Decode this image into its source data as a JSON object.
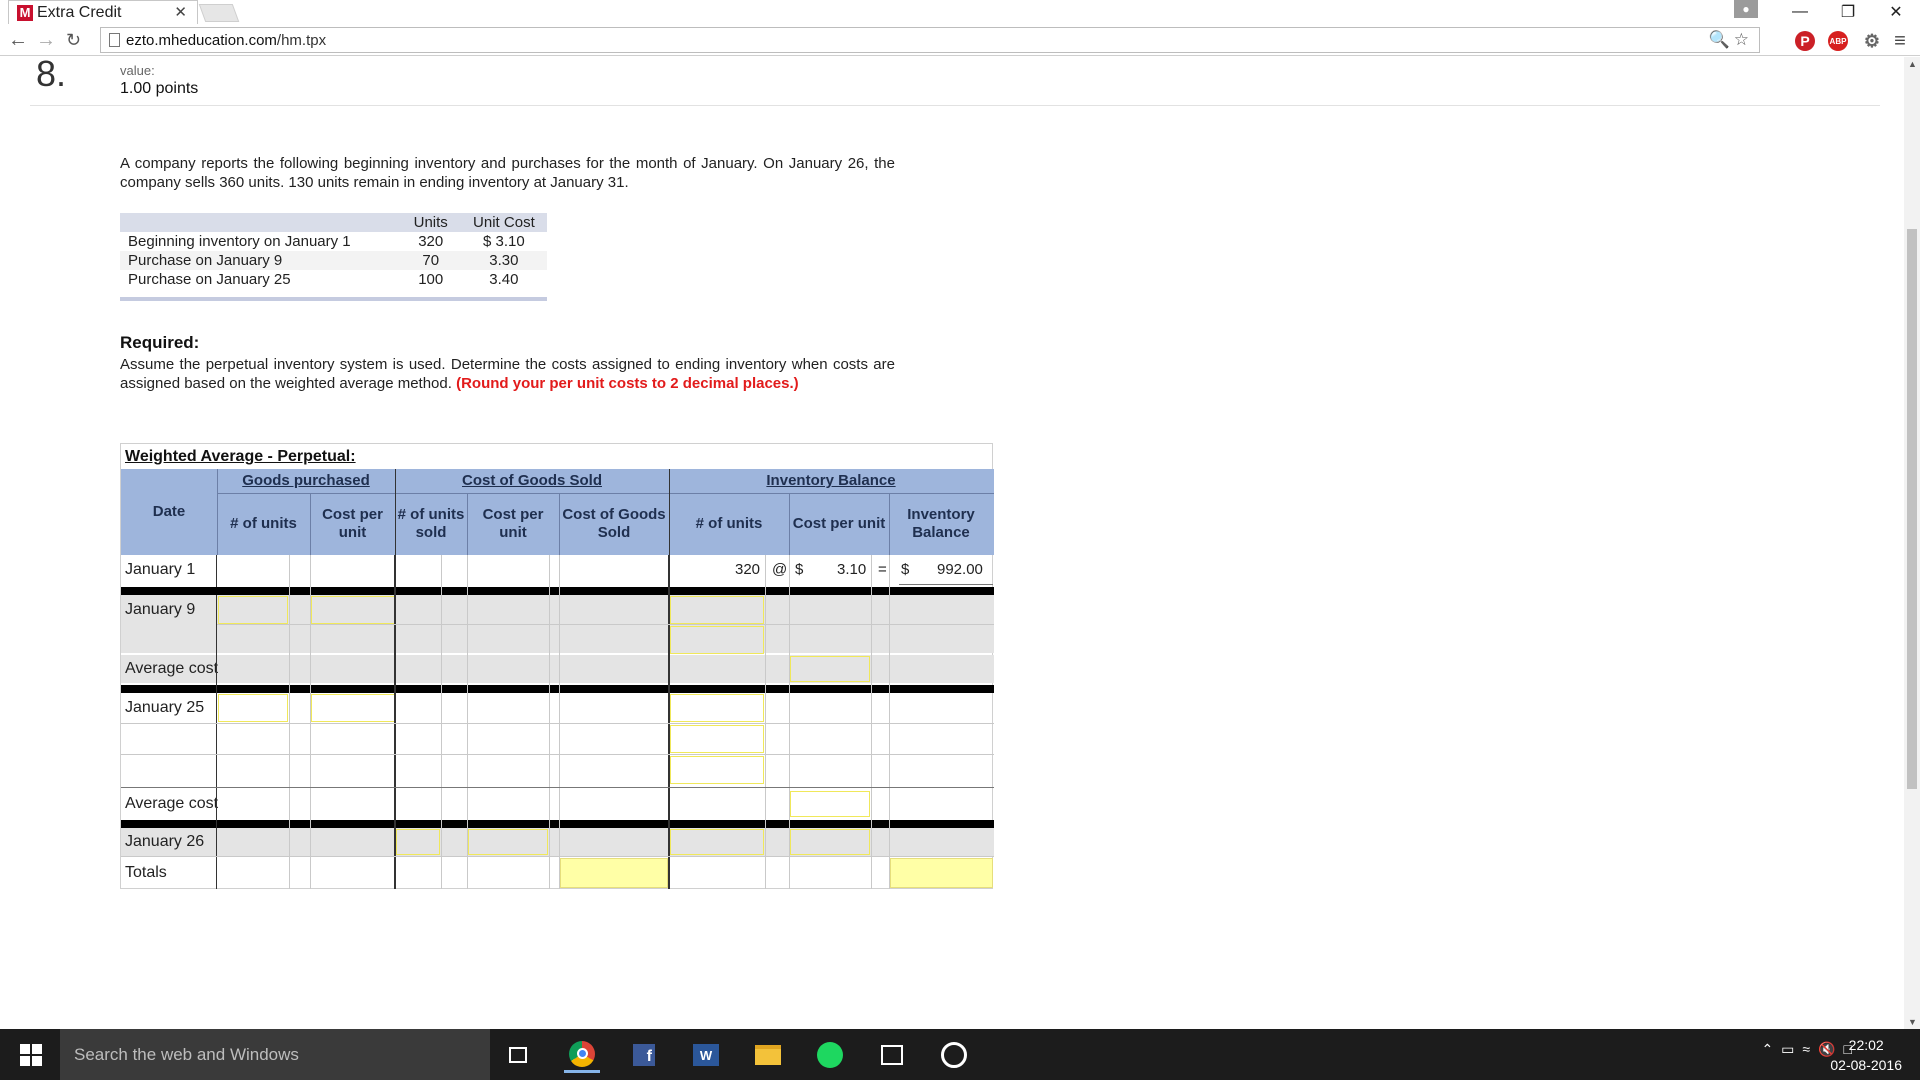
{
  "browser": {
    "tab_title": "Extra Credit",
    "tab_favicon": "M",
    "url_host": "ezto.mheducation.com",
    "url_path": "/hm.tpx",
    "ext_abp": "ABP"
  },
  "question": {
    "number": "8.",
    "value_label": "value:",
    "points": "1.00 points",
    "intro": "A company reports the following beginning inventory and purchases for the month of January. On January 26, the company sells 360 units. 130 units remain in ending inventory at January 31.",
    "data_table": {
      "headers": [
        "",
        "Units",
        "Unit Cost"
      ],
      "rows": [
        {
          "label": "Beginning inventory on January 1",
          "units": "320",
          "cost": "$ 3.10"
        },
        {
          "label": "Purchase on January 9",
          "units": "70",
          "cost": "3.30"
        },
        {
          "label": "Purchase on January 25",
          "units": "100",
          "cost": "3.40"
        }
      ]
    },
    "required_title": "Required:",
    "required_text": "Assume the perpetual inventory system is used. Determine the costs assigned to ending inventory when costs are assigned based on the weighted average method.",
    "required_red": "(Round your per unit costs to 2 decimal places.)"
  },
  "worksheet": {
    "title": "Weighted Average - Perpetual:",
    "groups": {
      "purchased": "Goods purchased",
      "cogs": "Cost of Goods Sold",
      "balance": "Inventory Balance"
    },
    "headers": {
      "date": "Date",
      "gp_units": "# of units",
      "gp_cost": "Cost per unit",
      "cogs_units": "# of units sold",
      "cogs_cost": "Cost per unit",
      "cogs_total": "Cost of Goods Sold",
      "ib_units": "# of units",
      "ib_cost": "Cost per unit",
      "ib_balance": "Inventory Balance"
    },
    "rows": {
      "jan1": "January 1",
      "jan9": "January 9",
      "avg1": "Average cost",
      "jan25": "January 25",
      "avg2": "Average cost",
      "jan26": "January 26",
      "totals": "Totals"
    },
    "jan1_values": {
      "units": "320",
      "at": "@",
      "dollar1": "$",
      "cost": "3.10",
      "eq": "=",
      "dollar2": "$",
      "balance": "992.00"
    }
  },
  "taskbar": {
    "search_placeholder": "Search the web and Windows",
    "time": "22:02",
    "date": "02-08-2016"
  }
}
